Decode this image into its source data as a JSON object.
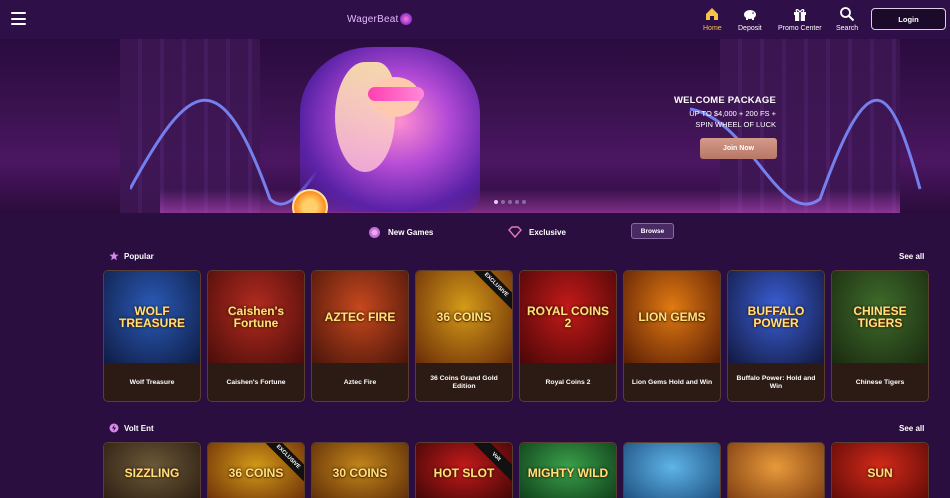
{
  "header": {
    "logo_text": "WagerBeat",
    "nav": [
      {
        "label": "Home",
        "icon": "home-icon",
        "active": true
      },
      {
        "label": "Deposit",
        "icon": "piggy-bank-icon",
        "active": false
      },
      {
        "label": "Promo Center",
        "icon": "gift-icon",
        "active": false
      },
      {
        "label": "Search",
        "icon": "search-icon",
        "active": false
      }
    ],
    "login_label": "Login"
  },
  "banner": {
    "title": "WELCOME PACKAGE",
    "line1": "UP TO $4,000 + 200 FS +",
    "line2": "SPIN WHEEL OF LUCK",
    "cta": "Join Now",
    "slides": 5,
    "active_slide": 0
  },
  "filters": {
    "new_games": "New Games",
    "exclusive": "Exclusive",
    "browse": "Browse"
  },
  "sections": [
    {
      "title": "Popular",
      "see_all": "See all",
      "games": [
        {
          "name": "Wolf Treasure",
          "art": "WOLF TREASURE",
          "colors": [
            "#2a5bb8",
            "#0f1c44"
          ]
        },
        {
          "name": "Caishen's Fortune",
          "art": "Caishen's Fortune",
          "colors": [
            "#b32b1f",
            "#4b0d0a"
          ]
        },
        {
          "name": "Aztec Fire",
          "art": "AZTEC FIRE",
          "colors": [
            "#c7481e",
            "#4a150a"
          ]
        },
        {
          "name": "36 Coins Grand Gold Edition",
          "art": "36 COINS",
          "colors": [
            "#d49b18",
            "#6a2c08"
          ],
          "ribbon": "EXCLUSIVE"
        },
        {
          "name": "Royal Coins 2",
          "art": "ROYAL COINS 2",
          "colors": [
            "#c41a1a",
            "#4a0606"
          ]
        },
        {
          "name": "Lion Gems Hold and Win",
          "art": "LION GEMS",
          "colors": [
            "#e07a12",
            "#5a1d05"
          ]
        },
        {
          "name": "Buffalo Power: Hold and Win",
          "art": "BUFFALO POWER",
          "colors": [
            "#3a5fd6",
            "#12183e"
          ]
        },
        {
          "name": "Chinese Tigers",
          "art": "CHINESE TIGERS",
          "colors": [
            "#3f6c2b",
            "#1a2a10"
          ]
        }
      ]
    },
    {
      "title": "Volt Ent",
      "see_all": "See all",
      "games": [
        {
          "art": "SIZZLING",
          "colors": [
            "#6d5a3a",
            "#2a1c10"
          ]
        },
        {
          "art": "36 COINS",
          "colors": [
            "#d49b18",
            "#6a2c08"
          ],
          "ribbon": "EXCLUSIVE"
        },
        {
          "art": "30 COINS",
          "colors": [
            "#c4861a",
            "#5a2a08"
          ]
        },
        {
          "art": "HOT SLOT",
          "colors": [
            "#c41a1a",
            "#3a0606"
          ],
          "ribbon": "Volt"
        },
        {
          "art": "MIGHTY WILD",
          "colors": [
            "#3aa14a",
            "#0e3a18"
          ]
        },
        {
          "art": "",
          "colors": [
            "#5fb4e8",
            "#1a4a7a"
          ]
        },
        {
          "art": "",
          "colors": [
            "#e89a3a",
            "#7a3a10"
          ]
        },
        {
          "art": "SUN",
          "colors": [
            "#d42a1a",
            "#5a0a06"
          ]
        }
      ]
    }
  ]
}
